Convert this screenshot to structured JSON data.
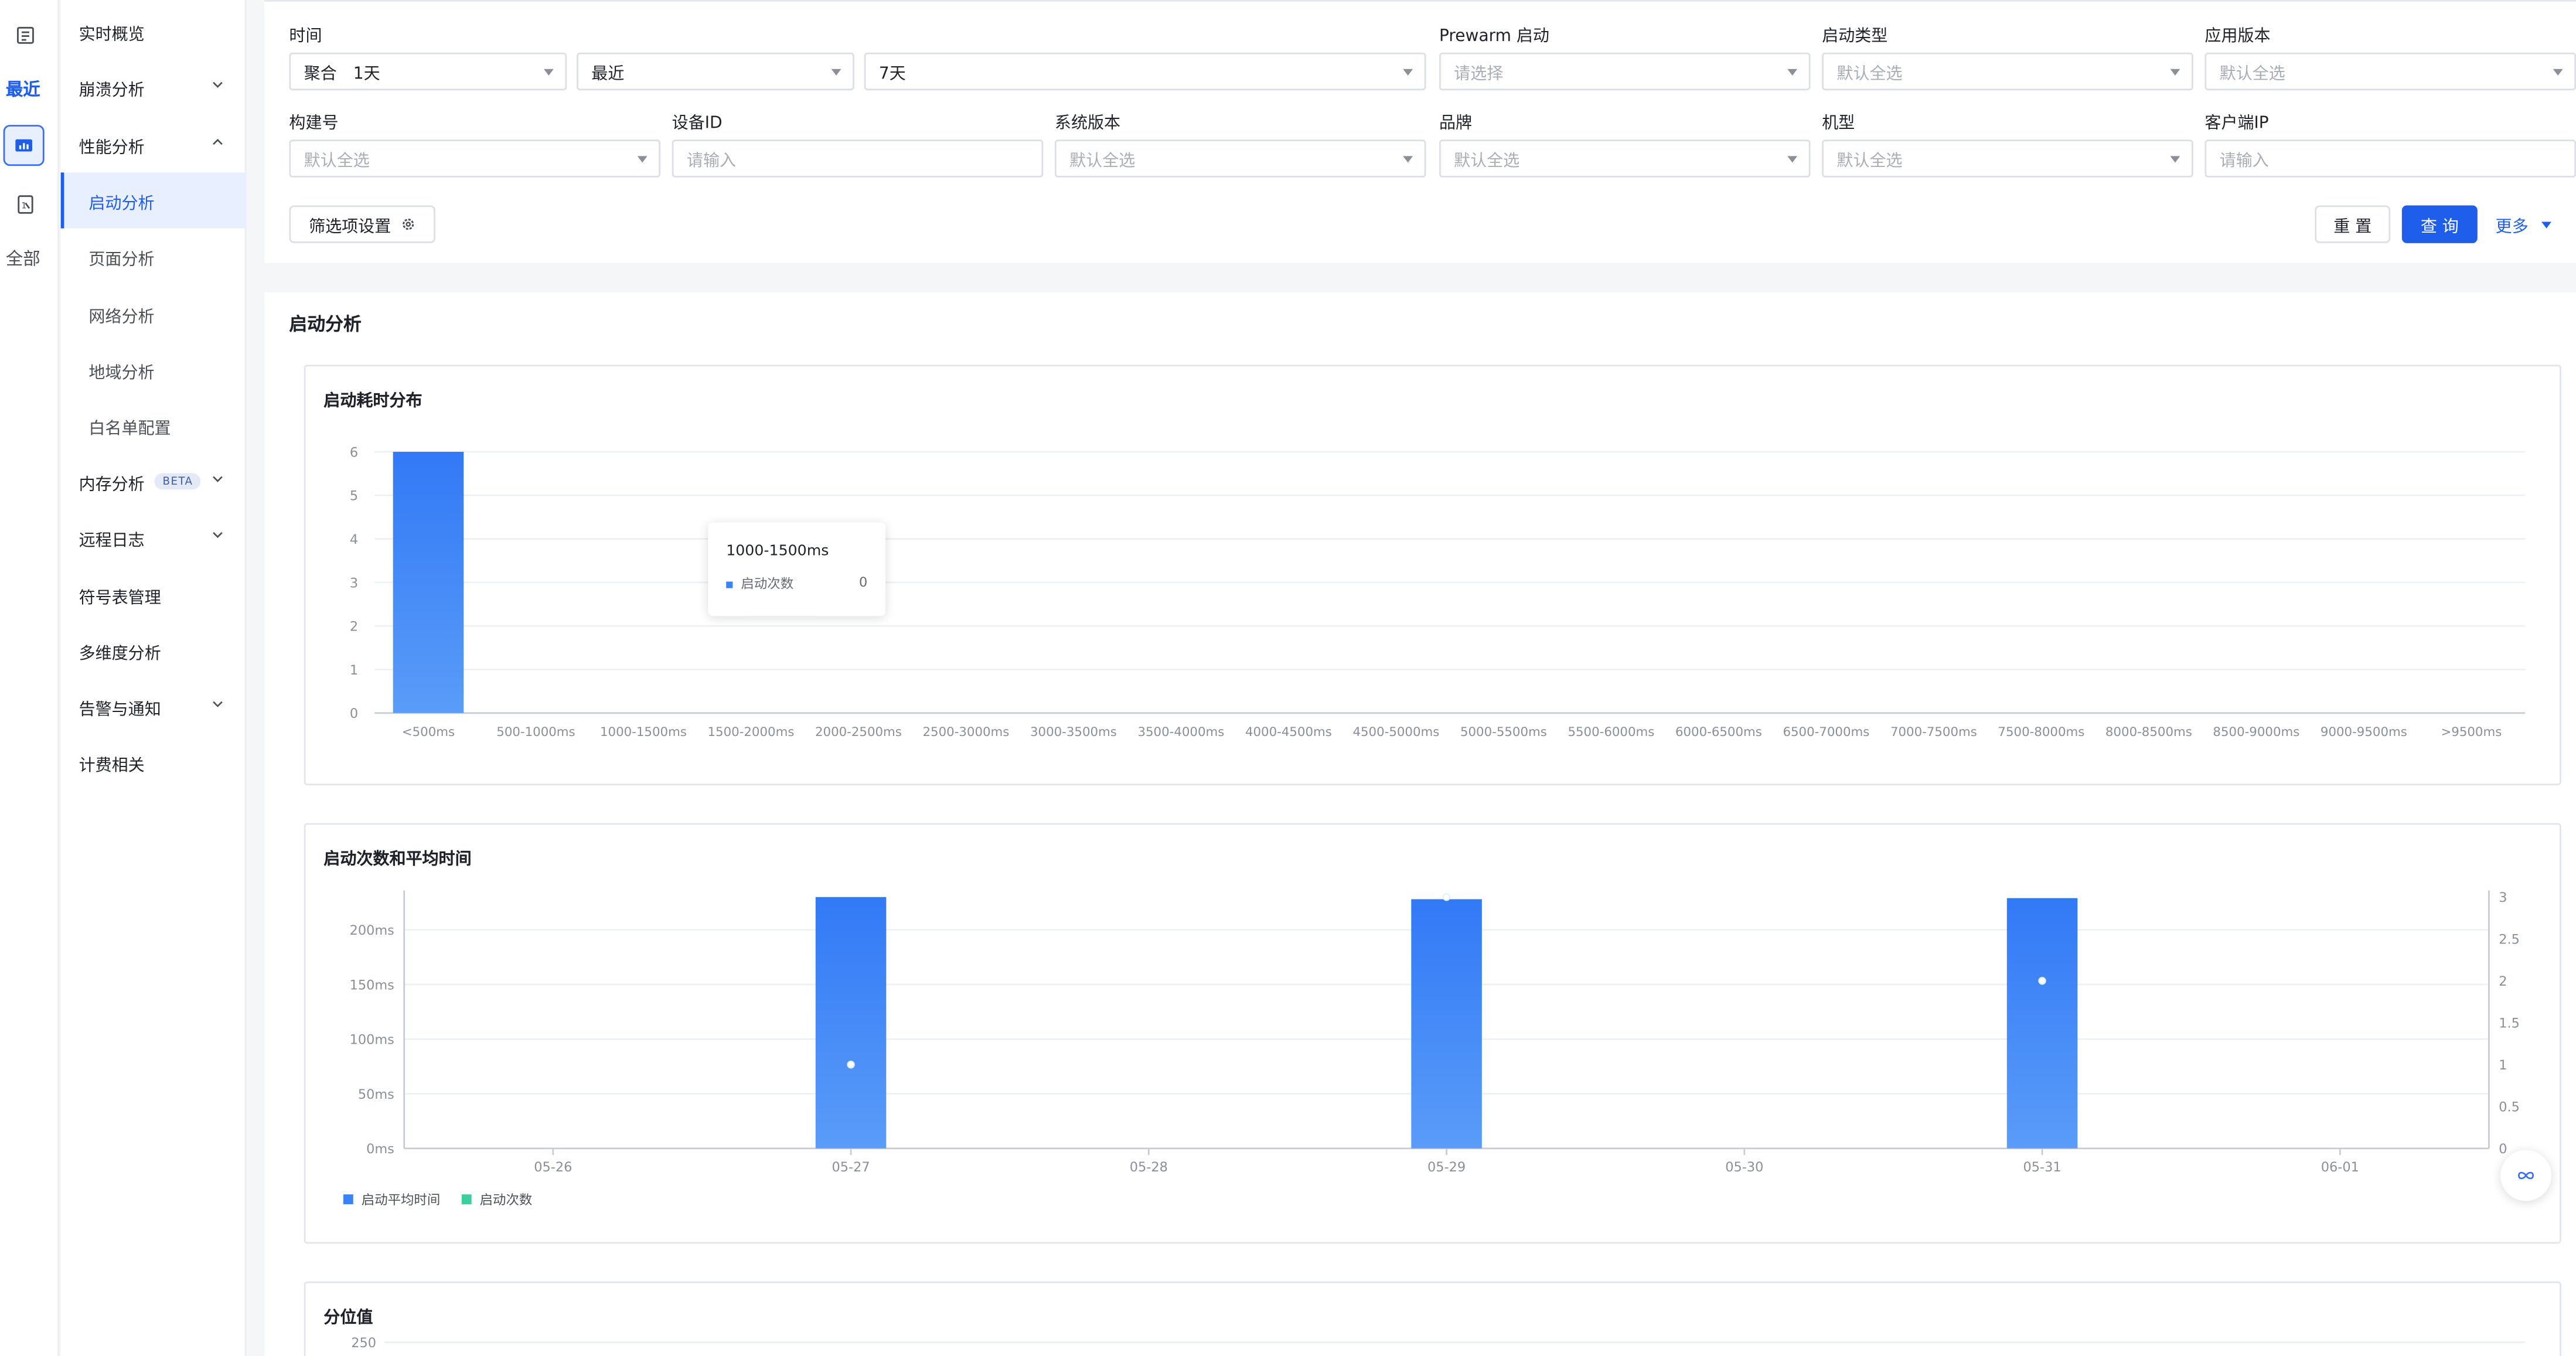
{
  "iconbar": {
    "recent": "最近",
    "all": "全部"
  },
  "sidebar": {
    "items": [
      {
        "label": "实时概览"
      },
      {
        "label": "崩溃分析"
      },
      {
        "label": "性能分析"
      },
      {
        "label": "启动分析"
      },
      {
        "label": "页面分析"
      },
      {
        "label": "网络分析"
      },
      {
        "label": "地域分析"
      },
      {
        "label": "白名单配置"
      },
      {
        "label": "内存分析",
        "badge": "BETA"
      },
      {
        "label": "远程日志"
      },
      {
        "label": "符号表管理"
      },
      {
        "label": "多维度分析"
      },
      {
        "label": "告警与通知"
      },
      {
        "label": "计费相关"
      }
    ]
  },
  "filters": {
    "time_label": "时间",
    "time_agg": "聚合",
    "time_agg_value": "1天",
    "time_range": "最近",
    "time_span": "7天",
    "prewarm_label": "Prewarm 启动",
    "prewarm_placeholder": "请选择",
    "launch_type_label": "启动类型",
    "launch_type_value": "默认全选",
    "app_version_label": "应用版本",
    "app_version_value": "默认全选",
    "build_label": "构建号",
    "build_value": "默认全选",
    "device_id_label": "设备ID",
    "device_id_placeholder": "请输入",
    "os_version_label": "系统版本",
    "os_version_value": "默认全选",
    "brand_label": "品牌",
    "brand_value": "默认全选",
    "model_label": "机型",
    "model_value": "默认全选",
    "client_ip_label": "客户端IP",
    "client_ip_placeholder": "请输入",
    "settings_button": "筛选项设置",
    "reset_button": "重 置",
    "query_button": "查 询",
    "more_button": "更多"
  },
  "section_title": "启动分析",
  "colors": {
    "accent": "#1f5eea",
    "bar": "#3a82f7",
    "series_count": "#3ccf9b"
  },
  "chart_data": [
    {
      "type": "bar",
      "title": "启动耗时分布",
      "categories": [
        "<500ms",
        "500-1000ms",
        "1000-1500ms",
        "1500-2000ms",
        "2000-2500ms",
        "2500-3000ms",
        "3000-3500ms",
        "3500-4000ms",
        "4000-4500ms",
        "4500-5000ms",
        "5000-5500ms",
        "5500-6000ms",
        "6000-6500ms",
        "6500-7000ms",
        "7000-7500ms",
        "7500-8000ms",
        "8000-8500ms",
        "8500-9000ms",
        "9000-9500ms",
        ">9500ms"
      ],
      "values": [
        6,
        0,
        0,
        0,
        0,
        0,
        0,
        0,
        0,
        0,
        0,
        0,
        0,
        0,
        0,
        0,
        0,
        0,
        0,
        0
      ],
      "ylim": [
        0,
        6
      ],
      "yticks": [
        "0",
        "1",
        "2",
        "3",
        "4",
        "5",
        "6"
      ],
      "grid": true,
      "tooltip": {
        "category": "1000-1500ms",
        "series": "启动次数",
        "value": "0"
      }
    },
    {
      "type": "bar",
      "title": "启动次数和平均时间",
      "categories": [
        "05-26",
        "05-27",
        "05-28",
        "05-29",
        "05-30",
        "05-31",
        "06-01"
      ],
      "series": [
        {
          "name": "启动平均时间",
          "type": "bar",
          "values": [
            0,
            230,
            0,
            228,
            0,
            229,
            0
          ]
        },
        {
          "name": "启动次数",
          "type": "line",
          "values": [
            null,
            1,
            null,
            3,
            null,
            2,
            null
          ]
        }
      ],
      "ylim": [
        0,
        230
      ],
      "yticks_left": [
        "0ms",
        "50ms",
        "100ms",
        "150ms",
        "200ms"
      ],
      "ylim_right": [
        0,
        3
      ],
      "yticks_right": [
        "0",
        "0.5",
        "1",
        "1.5",
        "2",
        "2.5",
        "3"
      ],
      "legend": "bottom-left",
      "grid": true
    },
    {
      "type": "line",
      "title": "分位值",
      "yticks": [
        "250"
      ]
    }
  ]
}
